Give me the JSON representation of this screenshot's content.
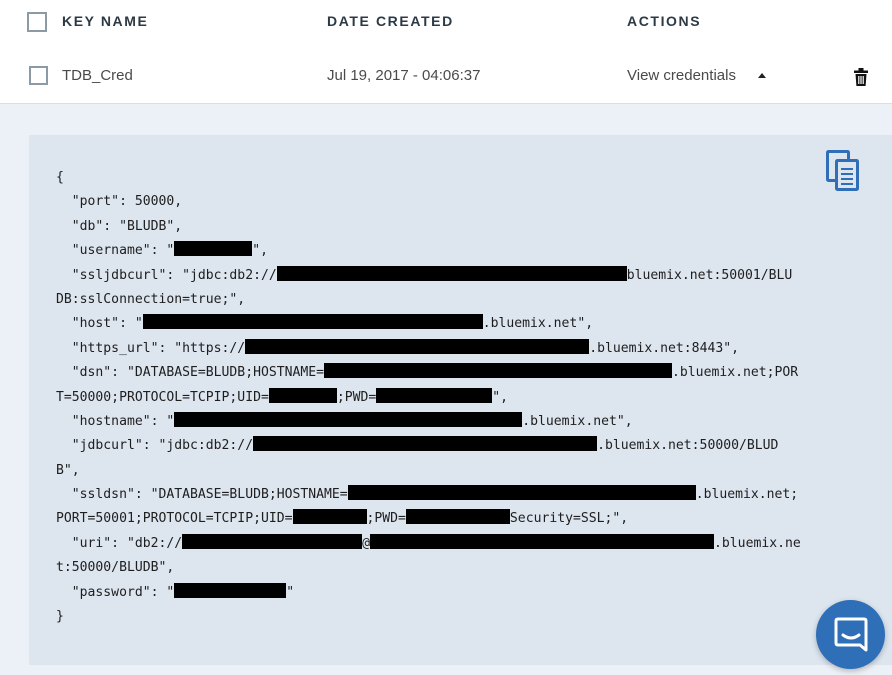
{
  "table": {
    "headers": {
      "key_name": "KEY NAME",
      "date_created": "DATE CREATED",
      "actions": "ACTIONS"
    },
    "row": {
      "key_name": "TDB_Cred",
      "date_created": "Jul 19, 2017 - 04:06:37",
      "action_label": "View credentials"
    }
  },
  "credentials": {
    "open_brace": "{",
    "close_brace": "}",
    "port": "  \"port\": 50000,",
    "db": "  \"db\": \"BLUDB\",",
    "username_prefix": "  \"username\": \"",
    "username_suffix": "\",",
    "ssljdbcurl_prefix": "  \"ssljdbcurl\": \"jdbc:db2://",
    "ssljdbcurl_suffix": "bluemix.net:50001/BLU",
    "ssljdbcurl_cont": "DB:sslConnection=true;\",",
    "host_prefix": "  \"host\": \"",
    "host_suffix": ".bluemix.net\",",
    "https_prefix": "  \"https_url\": \"https://",
    "https_suffix": ".bluemix.net:8443\",",
    "dsn_prefix": "  \"dsn\": \"DATABASE=BLUDB;HOSTNAME=",
    "dsn_suffix": ".bluemix.net;POR",
    "dsn_cont_prefix": "T=50000;PROTOCOL=TCPIP;UID=",
    "dsn_cont_mid": ";PWD=",
    "dsn_cont_suffix": "\",",
    "hostname_prefix": "  \"hostname\": \"",
    "hostname_suffix": ".bluemix.net\",",
    "jdbcurl_prefix": "  \"jdbcurl\": \"jdbc:db2://",
    "jdbcurl_suffix": ".bluemix.net:50000/BLUD",
    "jdbcurl_cont": "B\",",
    "ssldsn_prefix": "  \"ssldsn\": \"DATABASE=BLUDB;HOSTNAME=",
    "ssldsn_suffix": ".bluemix.net;",
    "ssldsn_cont_prefix": "PORT=50001;PROTOCOL=TCPIP;UID=",
    "ssldsn_cont_mid": ";PWD=",
    "ssldsn_cont_suffix": "Security=SSL;\",",
    "uri_prefix": "  \"uri\": \"db2://",
    "uri_at": "@",
    "uri_suffix": ".bluemix.ne",
    "uri_cont": "t:50000/BLUDB\",",
    "password_prefix": "  \"password\": \"",
    "password_suffix": "\""
  },
  "icons": {
    "copy": "copy-icon",
    "delete": "trash-icon",
    "expand": "caret-up-icon",
    "chat": "chat-icon"
  },
  "colors": {
    "accent": "#2e6fb8",
    "panel": "#ecf1f7",
    "code_bg": "#dde5ef"
  }
}
